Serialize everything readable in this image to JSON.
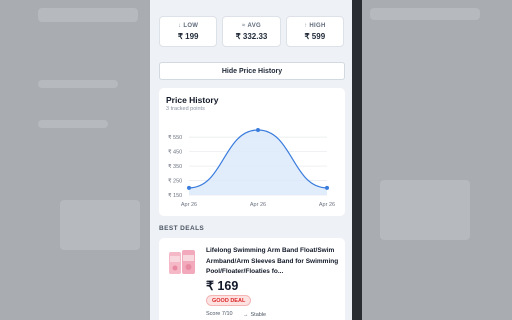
{
  "stats": [
    {
      "label": "LOW",
      "arrow": "↓",
      "value": "₹ 199"
    },
    {
      "label": "AVG",
      "arrow": "≈",
      "value": "₹ 332.33"
    },
    {
      "label": "HIGH",
      "arrow": "↑",
      "value": "₹ 599"
    }
  ],
  "hide_button_label": "Hide Price History",
  "history": {
    "title": "Price History",
    "subtitle": "3 tracked points"
  },
  "chart_data": {
    "type": "line",
    "title": "Price History",
    "categories": [
      "Apr 26",
      "Apr 26",
      "Apr 26"
    ],
    "series": [
      {
        "values": [
          199,
          599,
          199
        ]
      }
    ],
    "y_ticks": [
      "₹ 550",
      "₹ 450",
      "₹ 350",
      "₹ 250",
      "₹ 150"
    ],
    "y_tick_values": [
      550,
      450,
      350,
      250,
      150
    ],
    "ylim": [
      150,
      599
    ],
    "grid": true,
    "line_color": "#3b7ddd",
    "fill_color": "#dbe8fb"
  },
  "deals": {
    "heading": "BEST DEALS",
    "item": {
      "title": "Lifelong Swimming Arm Band Float/Swim Armband/Arm Sleeves Band for Swimming Pool/Floater/Floaties fo...",
      "price": "₹ 169",
      "badge": "GOOD DEAL",
      "score": "Score 7/10",
      "trend": "Stable",
      "trend_icon": "arrow-right-icon"
    }
  },
  "colors": {
    "accent": "#3b7ddd",
    "badge_red": "#dc2626",
    "panel_bg": "#eef1f5"
  }
}
